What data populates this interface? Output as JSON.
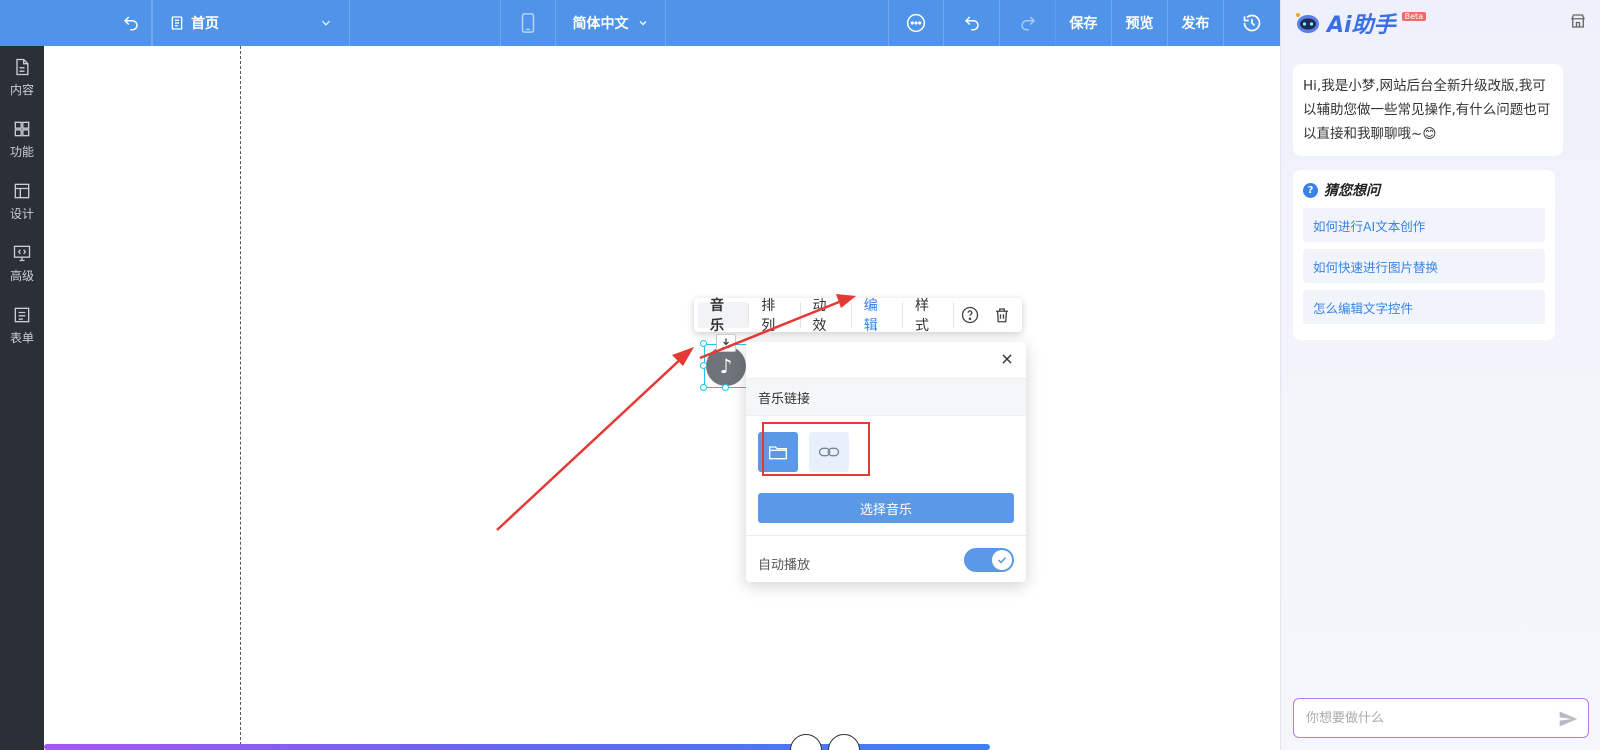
{
  "topbar": {
    "page_name": "首页",
    "language": "简体中文",
    "save": "保存",
    "preview": "预览",
    "publish": "发布"
  },
  "left_rail": {
    "items": [
      {
        "label": "内容",
        "icon": "document-icon"
      },
      {
        "label": "功能",
        "icon": "grid-icon"
      },
      {
        "label": "设计",
        "icon": "layout-icon"
      },
      {
        "label": "高级",
        "icon": "code-monitor-icon"
      },
      {
        "label": "表单",
        "icon": "form-icon"
      }
    ]
  },
  "element_toolbar": {
    "tabs": [
      "音乐",
      "排列",
      "动效",
      "编辑",
      "样式"
    ],
    "active": "音乐"
  },
  "music_popup": {
    "header": "音乐链接",
    "choose_button": "选择音乐",
    "autoplay_label": "自动播放",
    "autoplay_on": true
  },
  "ai_panel": {
    "title": "Ai助手",
    "badge": "Beta",
    "greeting": "Hi,我是小梦,网站后台全新升级改版,我可以辅助您做一些常见操作,有什么问题也可以直接和我聊聊哦~",
    "greeting_emoji": "😊",
    "guess_title": "猜您想问",
    "questions": [
      "如何进行AI文本创作",
      "如何快速进行图片替换",
      "怎么编辑文字控件"
    ],
    "input_placeholder": "你想要做什么"
  },
  "colors": {
    "topbar": "#4f94e8",
    "rail": "#2b3038",
    "accent": "#5b98e6",
    "annotation_red": "#e53935"
  }
}
